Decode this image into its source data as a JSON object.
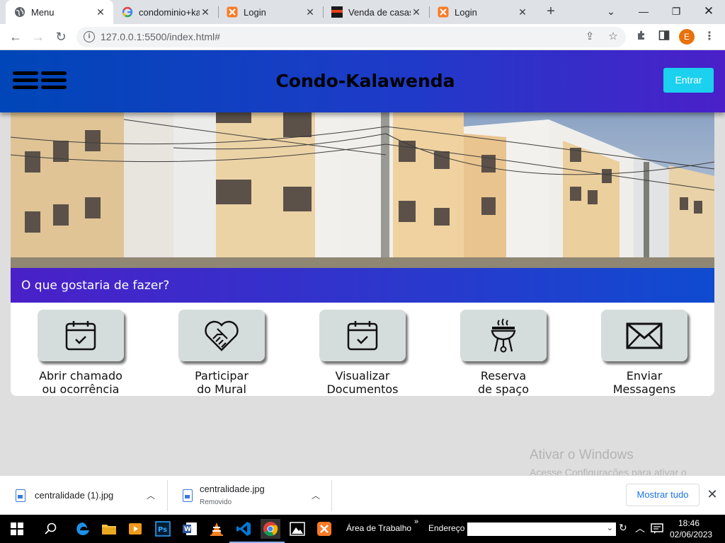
{
  "browser": {
    "tabs": [
      {
        "title": "Menu",
        "favicon": "globe-icon",
        "active": true
      },
      {
        "title": "condominio+kalawenda",
        "favicon": "google-icon",
        "active": false
      },
      {
        "title": "Login",
        "favicon": "xampp-icon",
        "active": false
      },
      {
        "title": "Venda de casas",
        "favicon": "site-favicon",
        "active": false
      },
      {
        "title": "Login",
        "favicon": "xampp-icon",
        "active": false
      }
    ],
    "new_tab": "+",
    "url": "127.0.0.1:5500/index.html#",
    "profile_initial": "E"
  },
  "site": {
    "title": "Condo-Kalawenda",
    "login_label": "Entrar",
    "prompt": "O que gostaria de fazer?",
    "header_gradient": [
      "#0046b8",
      "#4b20c9"
    ],
    "accent": "#1bd1ee",
    "actions": [
      {
        "line1": "Abrir chamado",
        "line2": "ou ocorrência",
        "icon": "calendar-check-icon"
      },
      {
        "line1": "Participar",
        "line2": "do Mural",
        "icon": "heart-handshake-icon"
      },
      {
        "line1": "Visualizar",
        "line2": "Documentos",
        "icon": "calendar-check-icon"
      },
      {
        "line1": "Reserva",
        "line2": "de spaço",
        "icon": "barbecue-grill-icon"
      },
      {
        "line1": "Enviar",
        "line2": "Messagens",
        "icon": "envelope-icon"
      }
    ]
  },
  "windows_watermark": {
    "title": "Ativar o Windows",
    "body": "Acesse Configurações para ativar o Windows."
  },
  "downloads": {
    "items": [
      {
        "name": "centralidade (1).jpg",
        "status": ""
      },
      {
        "name": "centralidade.jpg",
        "status": "Removido"
      }
    ],
    "show_all": "Mostrar tudo"
  },
  "taskbar": {
    "desktop_label": "Área de Trabalho",
    "address_label": "Endereço",
    "time": "18:46",
    "date": "02/06/2023"
  }
}
